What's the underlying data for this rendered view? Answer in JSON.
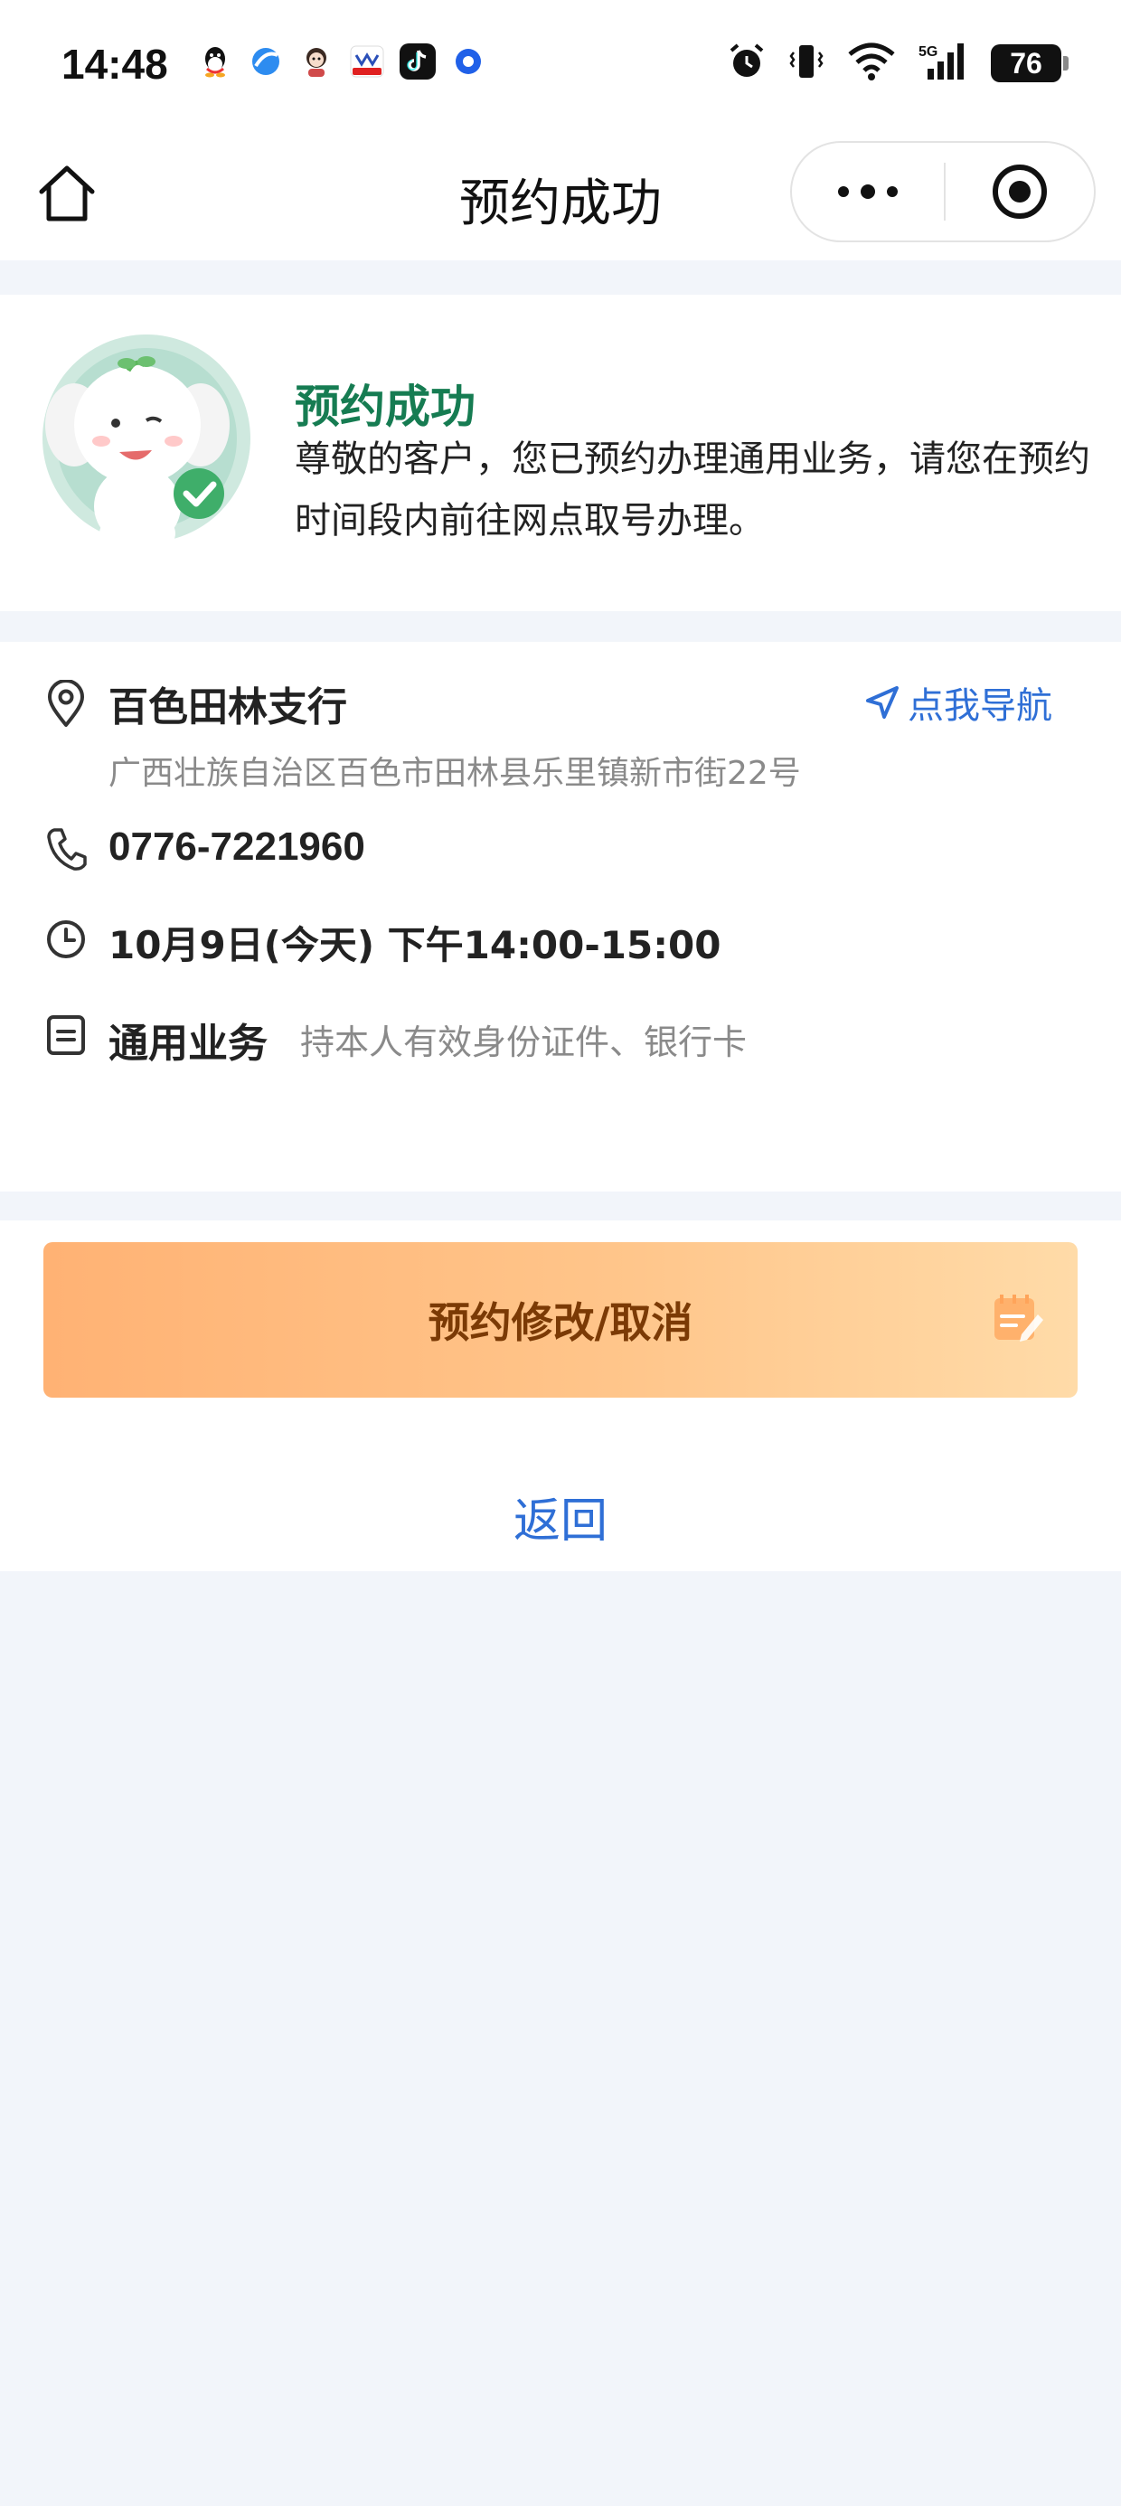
{
  "status_bar": {
    "time": "14:48",
    "battery": "76",
    "icons": [
      "qq-icon",
      "browser-icon",
      "avatar-app-icon",
      "news-app-icon",
      "tiktok-icon",
      "location-service-icon",
      "alarm-icon",
      "vibrate-icon",
      "wifi-icon",
      "5g-signal-icon"
    ]
  },
  "nav": {
    "title": "预约成功"
  },
  "success": {
    "title": "预约成功",
    "description": "尊敬的客户，您已预约办理通用业务，请您在预约时间段内前往网点取号办理。"
  },
  "branch": {
    "name": "百色田林支行",
    "navigate_label": "点我导航",
    "address": "广西壮族自治区百色市田林县乐里镇新市街22号",
    "phone": "0776-7221960",
    "time": "10月9日(今天) 下午14:00-15:00",
    "business_type": "通用业务",
    "requirements": "持本人有效身份证件、银行卡"
  },
  "actions": {
    "modify_label": "预约修改/取消",
    "back_label": "返回"
  },
  "colors": {
    "page_bg": "#f2f5fa",
    "success_green": "#167c52",
    "link_blue": "#2f6fd6",
    "button_gradient_start": "#ffb274",
    "button_gradient_end": "#ffdba8",
    "button_text": "#7b3a05"
  }
}
